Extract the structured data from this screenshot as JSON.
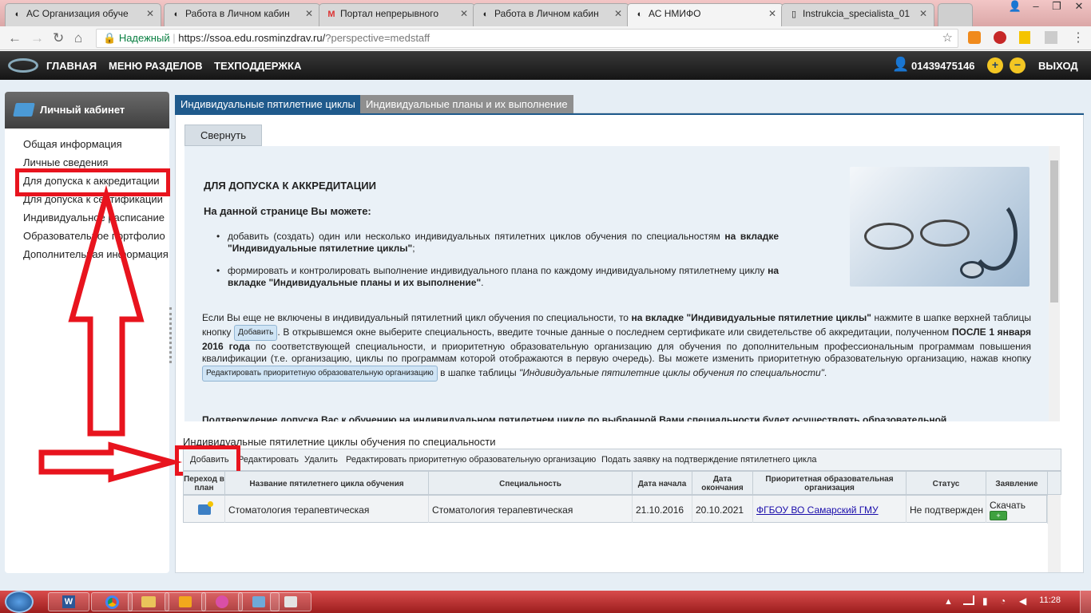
{
  "browser": {
    "tabs": [
      {
        "title": "АС Организация обуче",
        "icon": "site-icon"
      },
      {
        "title": "Работа в Личном кабин",
        "icon": "site-icon"
      },
      {
        "title": "Портал непрерывного",
        "icon": "gmail-icon"
      },
      {
        "title": "Работа в Личном кабин",
        "icon": "site-icon"
      },
      {
        "title": "АС НМИФО",
        "icon": "site-icon",
        "active": true
      },
      {
        "title": "Instrukcia_specialista_01",
        "icon": "document-icon"
      }
    ],
    "secure_label": "Надежный",
    "url_host": "https://ssoa.edu.rosminzdrav.ru/",
    "url_path": "?perspective=medstaff"
  },
  "site_header": {
    "nav": [
      "ГЛАВНАЯ",
      "МЕНЮ РАЗДЕЛОВ",
      "ТЕХПОДДЕРЖКА"
    ],
    "user_id": "01439475146",
    "exit_label": "ВЫХОД"
  },
  "sidebar": {
    "title": "Личный кабинет",
    "items": [
      "Общая информация",
      "Личные сведения",
      "Для допуска к аккредитации",
      "Для допуска к сертификации",
      "Индивидуальное расписание",
      "Образовательное портфолио",
      "Дополнительная информация"
    ]
  },
  "content_tabs": [
    {
      "label": "Индивидуальные пятилетние циклы",
      "active": true
    },
    {
      "label": "Индивидуальные планы и их выполнение",
      "active": false
    }
  ],
  "collapse_label": "Свернуть",
  "info": {
    "heading": "ДЛЯ ДОПУСКА К АККРЕДИТАЦИИ",
    "subheading": "На данной странице Вы можете:",
    "bullet1_text": "добавить (создать) один или несколько индивидуальных пятилетних циклов обучения по специальностям ",
    "bullet1_bold": "на вкладке \"Индивидуальные пятилетние циклы\"",
    "bullet1_end": ";",
    "bullet2_text": "формировать и контролировать выполнение индивидуального плана по каждому индивидуальному пятилетнему циклу ",
    "bullet2_bold": "на вкладке \"Индивидуальные планы и их выполнение\"",
    "bullet2_end": ".",
    "p1_a": "Если Вы еще не включены в индивидуальный пятилетний цикл обучения по специальности, то ",
    "p1_bold": "на вкладке \"Индивидуальные пятилетние циклы\"",
    "p1_b": " нажмите в шапке верхней таблицы кнопку",
    "inline_add": "Добавить",
    "p1_c": ". В открывшемся окне выберите специальность, введите точные данные о последнем сертификате или свидетельстве об аккредитации, полученном ",
    "p1_bold2": "ПОСЛЕ 1 января 2016 года",
    "p1_d": " по соответствующей специальности, и приоритетную образовательную организацию для обучения по дополнительным профессиональным программам повышения квалификации (т.е. организацию, циклы по программам которой отображаются в первую очередь). Вы можете изменить приоритетную образовательную организацию, нажав кнопку",
    "inline_edit": "Редактировать приоритетную образовательную организацию",
    "p1_e": " в шапке таблицы ",
    "p1_italic": "\"Индивидуальные пятилетние циклы обучения по специальности\"",
    "p1_f": ".",
    "p2_cut": "Подтверждение допуска Вас к обучению на индивидуальном пятилетнем цикле по выбранной Вами специальности будет осуществлять образовательной"
  },
  "table": {
    "caption": "Индивидуальные пятилетние циклы обучения по специальности",
    "toolbar": [
      "Добавить",
      "Редактировать",
      "Удалить",
      "Редактировать приоритетную образовательную организацию",
      "Подать заявку на подтверждение пятилетнего цикла"
    ],
    "headers": [
      "Переход в план",
      "Название пятилетнего цикла обучения",
      "Специальность",
      "Дата начала",
      "Дата окончания",
      "Приоритетная образовательная организация",
      "Статус",
      "Заявление"
    ],
    "rows": [
      {
        "name": "Стоматология терапевтическая",
        "specialty": "Стоматология терапевтическая",
        "start": "21.10.2016",
        "end": "20.10.2021",
        "org": "ФГБОУ ВО Самарский ГМУ",
        "status": "Не подтвержден",
        "download": "Скачать"
      }
    ]
  },
  "taskbar": {
    "time": "11:28"
  },
  "colors": {
    "highlight_red": "#e8141e",
    "active_tab": "#1f5a8c",
    "inactive_tab": "#8f8f8f",
    "link": "#1a0dab"
  }
}
